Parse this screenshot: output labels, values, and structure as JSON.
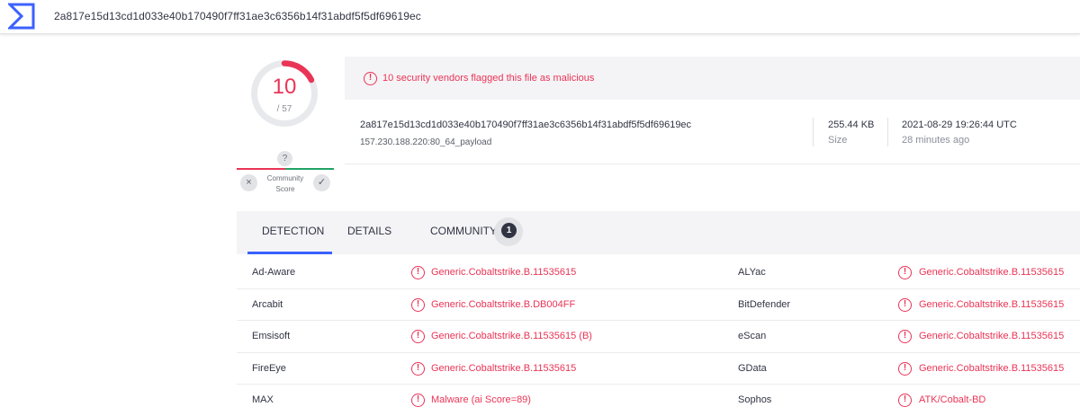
{
  "search": {
    "query": "2a817e15d13cd1d033e40b170490f7ff31ae3c6356b14f31abdf5f5df69619ec"
  },
  "colors": {
    "malicious": "#ea3456",
    "accent": "#3b61ff",
    "harmless": "#21a366"
  },
  "score": {
    "detections": "10",
    "total": "/ 57",
    "detections_value": 10,
    "total_value": 57
  },
  "community": {
    "unknown_icon": "?",
    "down_icon": "×",
    "up_icon": "✓",
    "label_line1": "Community",
    "label_line2": "Score"
  },
  "alert": {
    "icon": "!",
    "text": "10 security vendors flagged this file as malicious"
  },
  "file": {
    "hash": "2a817e15d13cd1d033e40b170490f7ff31ae3c6356b14f31abdf5f5df69619ec",
    "name": "157.230.188.220:80_64_payload",
    "size": "255.44 KB",
    "size_label": "Size",
    "date": "2021-08-29 19:26:44 UTC",
    "ago": "28 minutes ago"
  },
  "tabs": [
    {
      "label": "DETECTION",
      "active": true
    },
    {
      "label": "DETAILS",
      "active": false
    },
    {
      "label": "COMMUNITY",
      "active": false,
      "badge": "1"
    }
  ],
  "detections": [
    {
      "left_vendor": "Ad-Aware",
      "left_result": "Generic.Cobaltstrike.B.11535615",
      "right_vendor": "ALYac",
      "right_result": "Generic.Cobaltstrike.B.11535615"
    },
    {
      "left_vendor": "Arcabit",
      "left_result": "Generic.Cobaltstrike.B.DB004FF",
      "right_vendor": "BitDefender",
      "right_result": "Generic.Cobaltstrike.B.11535615"
    },
    {
      "left_vendor": "Emsisoft",
      "left_result": "Generic.Cobaltstrike.B.11535615 (B)",
      "right_vendor": "eScan",
      "right_result": "Generic.Cobaltstrike.B.11535615"
    },
    {
      "left_vendor": "FireEye",
      "left_result": "Generic.Cobaltstrike.B.11535615",
      "right_vendor": "GData",
      "right_result": "Generic.Cobaltstrike.B.11535615"
    },
    {
      "left_vendor": "MAX",
      "left_result": "Malware (ai Score=89)",
      "right_vendor": "Sophos",
      "right_result": "ATK/Cobalt-BD"
    }
  ]
}
